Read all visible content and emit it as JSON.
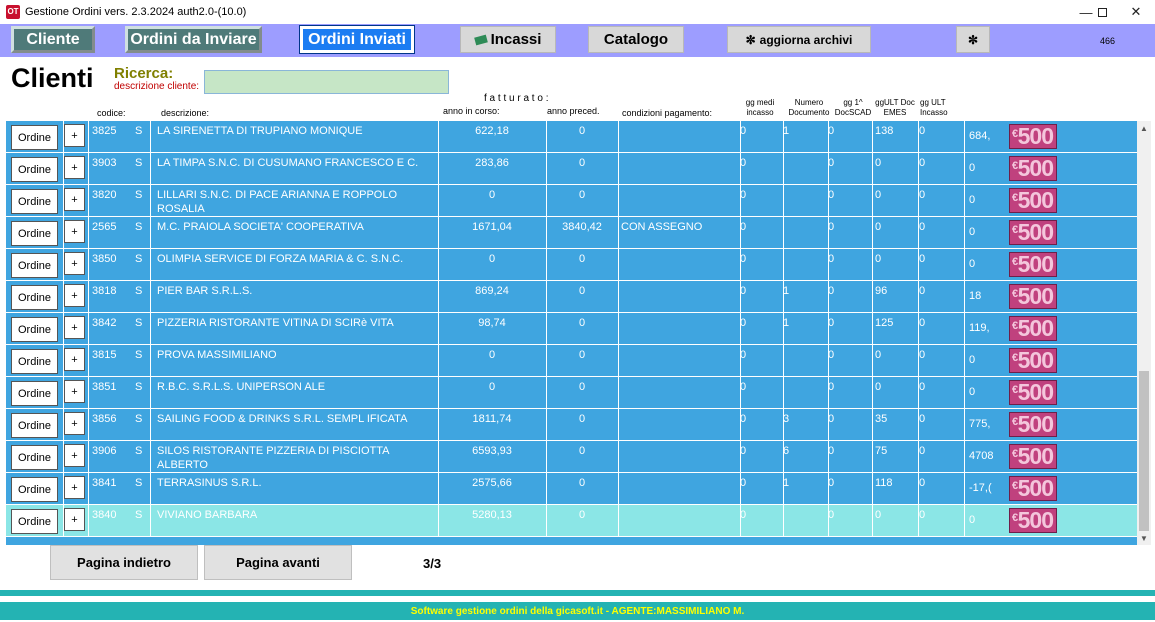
{
  "window": {
    "app_icon": "OT",
    "title": "Gestione Ordini vers. 2.3.2024 auth2.0-(10.0)",
    "minimize_icon": "minimize-icon",
    "maximize_icon": "maximize-icon",
    "close_icon": "close-icon"
  },
  "toolbar": {
    "cliente": "Cliente",
    "ordini_da_inviare": "Ordini da Inviare",
    "ordini_inviati": "Ordini Inviati",
    "incassi": "Incassi",
    "catalogo": "Catalogo",
    "aggiorna_archivi": "aggiorna archivi",
    "count": "466"
  },
  "header": {
    "title": "Clienti",
    "search_label": "Ricerca:",
    "search_sub": "descrizione cliente:",
    "search_value": ""
  },
  "columns": {
    "codice": "codice:",
    "descrizione": "descrizione:",
    "fatturato": "f a t t u r a t o :",
    "anno_corso": "anno in corso:",
    "anno_preced": "anno preced.",
    "condizioni": "condizioni pagamento:",
    "gg_medi": "gg medi incasso",
    "numero_doc": "Numero Documento",
    "gg_1": "gg 1^ DocSCAD",
    "gg_ult_doc": "ggULT Doc EMES",
    "gg_ult_inc": "gg ULT Incasso"
  },
  "row_buttons": {
    "ordine": "Ordine",
    "plus": "+"
  },
  "money_label": "500",
  "rows": [
    {
      "code": "3825",
      "s": "S",
      "desc": "LA SIRENETTA DI TRUPIANO MONIQUE",
      "cur": "622,18",
      "prev": "0",
      "cond": "",
      "gg_medi": "0",
      "num": "1",
      "gg1": "0",
      "ult_doc": "138",
      "ult_inc": "0",
      "last": "684,"
    },
    {
      "code": "3903",
      "s": "S",
      "desc": "LA TIMPA S.N.C. DI CUSUMANO FRANCESCO E C.",
      "cur": "283,86",
      "prev": "0",
      "cond": "",
      "gg_medi": "0",
      "num": "",
      "gg1": "0",
      "ult_doc": "0",
      "ult_inc": "0",
      "last": "0"
    },
    {
      "code": "3820",
      "s": "S",
      "desc": "LILLARI S.N.C. DI PACE ARIANNA E ROPPOLO ROSALIA",
      "cur": "0",
      "prev": "0",
      "cond": "",
      "gg_medi": "0",
      "num": "",
      "gg1": "0",
      "ult_doc": "0",
      "ult_inc": "0",
      "last": "0"
    },
    {
      "code": "2565",
      "s": "S",
      "desc": "M.C. PRAIOLA SOCIETA' COOPERATIVA",
      "cur": "1671,04",
      "prev": "3840,42",
      "cond": "CON ASSEGNO",
      "gg_medi": "0",
      "num": "",
      "gg1": "0",
      "ult_doc": "0",
      "ult_inc": "0",
      "last": "0"
    },
    {
      "code": "3850",
      "s": "S",
      "desc": "OLIMPIA SERVICE DI FORZA MARIA & C. S.N.C.",
      "cur": "0",
      "prev": "0",
      "cond": "",
      "gg_medi": "0",
      "num": "",
      "gg1": "0",
      "ult_doc": "0",
      "ult_inc": "0",
      "last": "0"
    },
    {
      "code": "3818",
      "s": "S",
      "desc": "PIER BAR S.R.L.S.",
      "cur": "869,24",
      "prev": "0",
      "cond": "",
      "gg_medi": "0",
      "num": "1",
      "gg1": "0",
      "ult_doc": "96",
      "ult_inc": "0",
      "last": "18"
    },
    {
      "code": "3842",
      "s": "S",
      "desc": "PIZZERIA RISTORANTE VITINA DI SCIRè VITA",
      "cur": "98,74",
      "prev": "0",
      "cond": "",
      "gg_medi": "0",
      "num": "1",
      "gg1": "0",
      "ult_doc": "125",
      "ult_inc": "0",
      "last": "119,"
    },
    {
      "code": "3815",
      "s": "S",
      "desc": "PROVA MASSIMILIANO",
      "cur": "0",
      "prev": "0",
      "cond": "",
      "gg_medi": "0",
      "num": "",
      "gg1": "0",
      "ult_doc": "0",
      "ult_inc": "0",
      "last": "0"
    },
    {
      "code": "3851",
      "s": "S",
      "desc": "R.B.C. S.R.L.S. UNIPERSON ALE",
      "cur": "0",
      "prev": "0",
      "cond": "",
      "gg_medi": "0",
      "num": "",
      "gg1": "0",
      "ult_doc": "0",
      "ult_inc": "0",
      "last": "0"
    },
    {
      "code": "3856",
      "s": "S",
      "desc": "SAILING FOOD & DRINKS S.R.L. SEMPL IFICATA",
      "cur": "1811,74",
      "prev": "0",
      "cond": "",
      "gg_medi": "0",
      "num": "3",
      "gg1": "0",
      "ult_doc": "35",
      "ult_inc": "0",
      "last": "775,"
    },
    {
      "code": "3906",
      "s": "S",
      "desc": "SILOS RISTORANTE PIZZERIA DI PISCIOTTA ALBERTO",
      "cur": "6593,93",
      "prev": "0",
      "cond": "",
      "gg_medi": "0",
      "num": "6",
      "gg1": "0",
      "ult_doc": "75",
      "ult_inc": "0",
      "last": "4708"
    },
    {
      "code": "3841",
      "s": "S",
      "desc": "TERRASINUS S.R.L.",
      "cur": "2575,66",
      "prev": "0",
      "cond": "",
      "gg_medi": "0",
      "num": "1",
      "gg1": "0",
      "ult_doc": "118",
      "ult_inc": "0",
      "last": "-17,("
    },
    {
      "code": "3840",
      "s": "S",
      "desc": "VIVIANO BARBARA",
      "cur": "5280,13",
      "prev": "0",
      "cond": "",
      "gg_medi": "0",
      "num": "",
      "gg1": "0",
      "ult_doc": "0",
      "ult_inc": "0",
      "last": "0",
      "selected": true
    }
  ],
  "pager": {
    "prev": "Pagina indietro",
    "next": "Pagina avanti",
    "count": "3/3"
  },
  "status": "Software gestione ordini della gicasoft.it - AGENTE:MASSIMILIANO M."
}
